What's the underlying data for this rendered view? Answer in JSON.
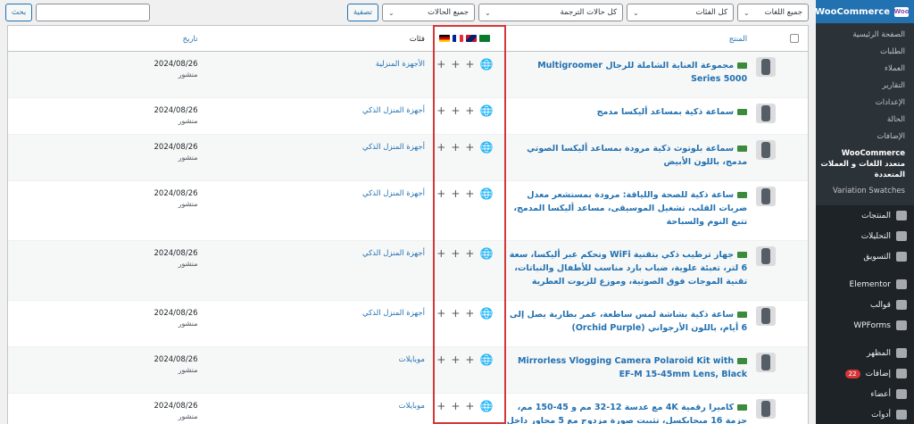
{
  "sidebar": {
    "header": {
      "icon_text": "Woo",
      "title": "WooCommerce"
    },
    "submenu": [
      {
        "label": "الصفحة الرئيسية",
        "current": false
      },
      {
        "label": "الطلبات",
        "current": false
      },
      {
        "label": "العملاء",
        "current": false
      },
      {
        "label": "التقارير",
        "current": false
      },
      {
        "label": "الإعدادات",
        "current": false
      },
      {
        "label": "الحالة",
        "current": false
      },
      {
        "label": "الإضافات",
        "current": false
      },
      {
        "label": "WooCommerce متعدد اللغات و العملات المتعددة",
        "current": true
      },
      {
        "label": "Variation Swatches",
        "current": false
      }
    ],
    "menu": [
      {
        "label": "المنتجات"
      },
      {
        "label": "التحليلات"
      },
      {
        "label": "التسويق"
      },
      {
        "label": "Elementor"
      },
      {
        "label": "قوالب"
      },
      {
        "label": "WPForms"
      },
      {
        "label": "المظهر"
      },
      {
        "label": "إضافات",
        "badge": "22"
      },
      {
        "label": "أعضاء"
      },
      {
        "label": "أدوات"
      }
    ]
  },
  "toolbar": {
    "languages": "جميع اللغات",
    "categories": "كل الفئات",
    "translation_status": "كل حالات الترجمة",
    "statuses": "جميع الحالات",
    "filter_btn": "تصفية",
    "search_placeholder": "",
    "search_btn": "بحث"
  },
  "table": {
    "headers": {
      "product": "المنتج",
      "category": "فئات",
      "date": "تاريخ"
    },
    "rows": [
      {
        "name": "مجموعة العناية الشاملة للرجال Multigroomer Series 5000",
        "category": "الأجهزة المنزلية",
        "date": "2024/08/26",
        "status": "منشور"
      },
      {
        "name": "سماعة ذكية بمساعد أليكسا مدمج",
        "category": "أجهزة المنزل الذكي",
        "date": "2024/08/26",
        "status": "منشور"
      },
      {
        "name": "سماعة بلوتوث ذكية مرودة بمساعد أليكسا الصوتي مدمج، باللون الأبيض",
        "category": "أجهزة المنزل الذكي",
        "date": "2024/08/26",
        "status": "منشور"
      },
      {
        "name": "ساعة ذكية للصحة واللياقة: مرودة بمستشعر معدل ضربات القلب، تشغيل الموسيقى، مساعد أليكسا المدمج، تتبع النوم والسباحة",
        "category": "أجهزة المنزل الذكي",
        "date": "2024/08/26",
        "status": "منشور"
      },
      {
        "name": "جهاز ترطيب ذكي بتقنية WiFi وتحكم عبر أليكسا، سعة 6 لتر، تعبئة علوية، ضباب بارد مناسب للأطفال والنباتات، تقنية الموجات فوق الصوتية، وموزع للزيوت العطرية",
        "category": "أجهزة المنزل الذكي",
        "date": "2024/08/26",
        "status": "منشور"
      },
      {
        "name": "ساعة ذكية بشاشة لمس ساطعة، عمر بطارية يصل إلى 6 أيام، باللون الأرجواني (Orchid Purple)",
        "category": "أجهزة المنزل الذكي",
        "date": "2024/08/26",
        "status": "منشور"
      },
      {
        "name": "Mirrorless Vlogging Camera Polaroid Kit with EF-M 15-45mm Lens, Black",
        "category": "موبايلات",
        "date": "2024/08/26",
        "status": "منشور"
      },
      {
        "name": "كاميرا رقمية 4K مع عدسة 12-32 مم و 45-150 مم، حزمة 16 ميجابكسل، تثبيت صورة مزدوج مع 5 محاور داخل",
        "category": "موبايلات",
        "date": "2024/08/26",
        "status": "منشور"
      }
    ]
  }
}
